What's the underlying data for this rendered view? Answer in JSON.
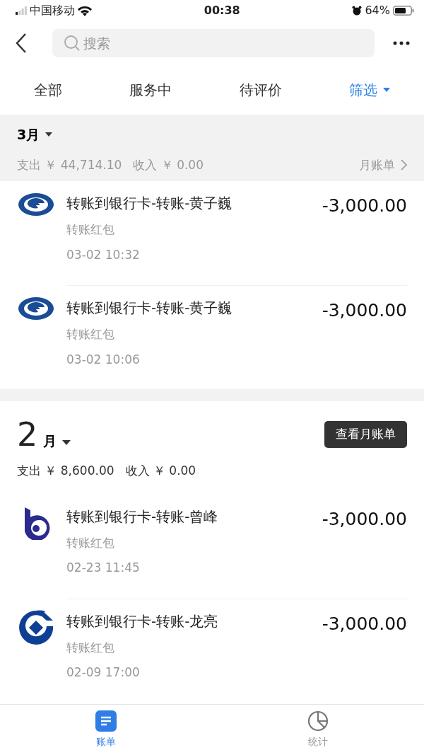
{
  "status_bar": {
    "carrier": "中国移动",
    "time": "00:38",
    "battery": "64%"
  },
  "search": {
    "placeholder": "搜索"
  },
  "tabs": [
    {
      "label": "全部",
      "selected": false
    },
    {
      "label": "服务中",
      "selected": false
    },
    {
      "label": "待评价",
      "selected": false
    },
    {
      "label": "筛选",
      "selected": false,
      "kind": "filter"
    }
  ],
  "months": [
    {
      "kind": "compact",
      "month": "3",
      "unit": "月",
      "expense_label": "支出",
      "expense": "￥ 44,714.10",
      "income_label": "收入",
      "income": "￥ 0.00",
      "link": "月账单",
      "transactions": [
        {
          "kind": "swirl",
          "title": "转账到银行卡-转账-黄子巍",
          "category": "转账红包",
          "time": "03-02  10:32",
          "amount": "-3,000.00"
        },
        {
          "kind": "swirl",
          "title": "转账到银行卡-转账-黄子巍",
          "category": "转账红包",
          "time": "03-02  10:06",
          "amount": "-3,000.00"
        }
      ]
    },
    {
      "kind": "large",
      "month": "2",
      "unit": "月",
      "expense_label": "支出",
      "expense": "￥ 8,600.00",
      "income_label": "收入",
      "income": "￥ 0.00",
      "link": "查看月账单",
      "transactions": [
        {
          "kind": "b-mark",
          "title": "转账到银行卡-转账-曾峰",
          "category": "转账红包",
          "time": "02-23  11:45",
          "amount": "-3,000.00"
        },
        {
          "kind": "diamond",
          "title": "转账到银行卡-转账-龙亮",
          "category": "转账红包",
          "time": "02-09  17:00",
          "amount": "-3,000.00"
        }
      ]
    }
  ],
  "bottom_tabs": [
    {
      "label": "账单",
      "selected": true,
      "kind": "bill"
    },
    {
      "label": "统计",
      "selected": false,
      "kind": "stats"
    }
  ]
}
